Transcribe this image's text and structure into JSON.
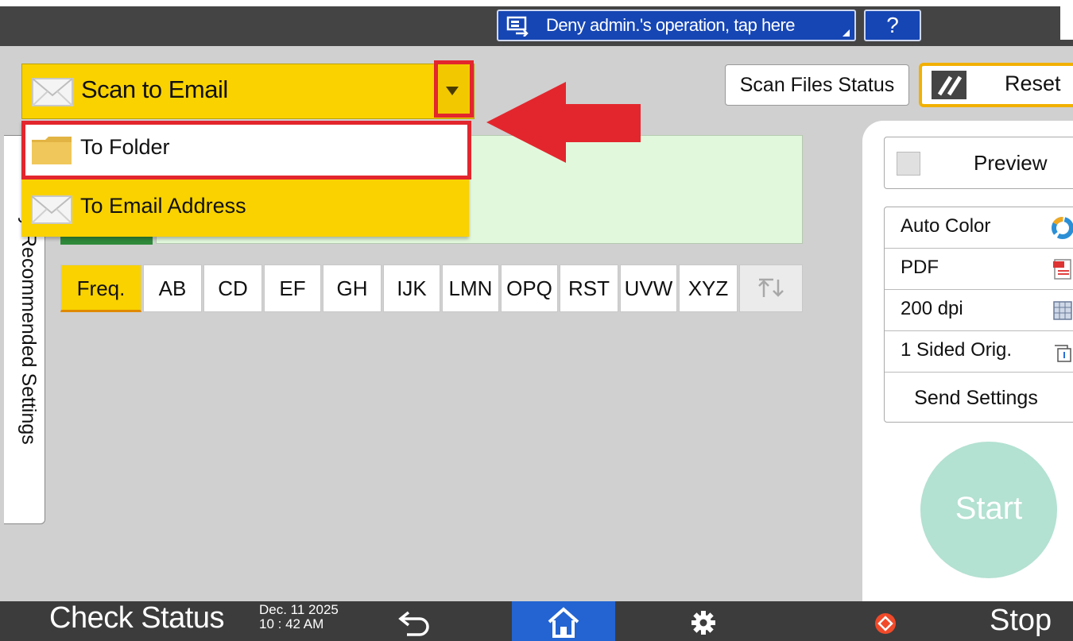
{
  "topbar": {
    "deny_label": "Deny admin.'s operation, tap here",
    "help_label": "?"
  },
  "mode": {
    "current": "Scan to Email",
    "options": [
      "To Folder",
      "To Email Address"
    ]
  },
  "side_tab": {
    "label": "Job History/Recommended Settings"
  },
  "tabs": [
    "Freq.",
    "AB",
    "CD",
    "EF",
    "GH",
    "IJK",
    "LMN",
    "OPQ",
    "RST",
    "UVW",
    "XYZ"
  ],
  "actions": {
    "scan_files_status": "Scan Files Status",
    "reset": "Reset"
  },
  "right": {
    "preview": "Preview",
    "settings": [
      "Auto Color",
      "PDF",
      "200 dpi",
      "1 Sided Orig."
    ],
    "send_settings": "Send Settings",
    "start": "Start"
  },
  "bottom": {
    "check_status": "Check Status",
    "date": "Dec. 11 2025",
    "time": "10 : 42 AM",
    "stop": "Stop"
  },
  "colors": {
    "mode_yellow": "#f9d200",
    "highlight_red": "#e3262d",
    "home_blue": "#2364d2",
    "start_mint": "#b3e1d2"
  }
}
